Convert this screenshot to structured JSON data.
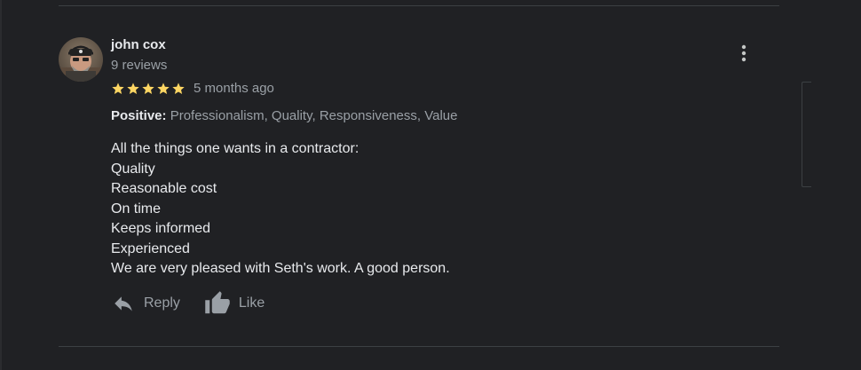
{
  "review": {
    "author_name": "john cox",
    "author_reviews": "9 reviews",
    "rating": 5,
    "rating_max": 5,
    "time_ago": "5 months ago",
    "positive_label": "Positive:",
    "positive_values": "Professionalism, Quality, Responsiveness, Value",
    "body_lines": [
      "All the things one wants in a contractor:",
      "Quality",
      "Reasonable cost",
      "On time",
      "Keeps informed",
      "Experienced",
      "We are very pleased with Seth's work. A good person."
    ]
  },
  "actions": {
    "reply_label": "Reply",
    "like_label": "Like"
  },
  "icons": {
    "more": "more-vert-icon",
    "reply": "reply-icon",
    "like": "thumbs-up-icon",
    "star": "star-icon"
  },
  "colors": {
    "background": "#202124",
    "star": "#fdd663",
    "text_primary": "#e8eaed",
    "text_secondary": "#9aa0a6",
    "divider": "#3c4043"
  }
}
